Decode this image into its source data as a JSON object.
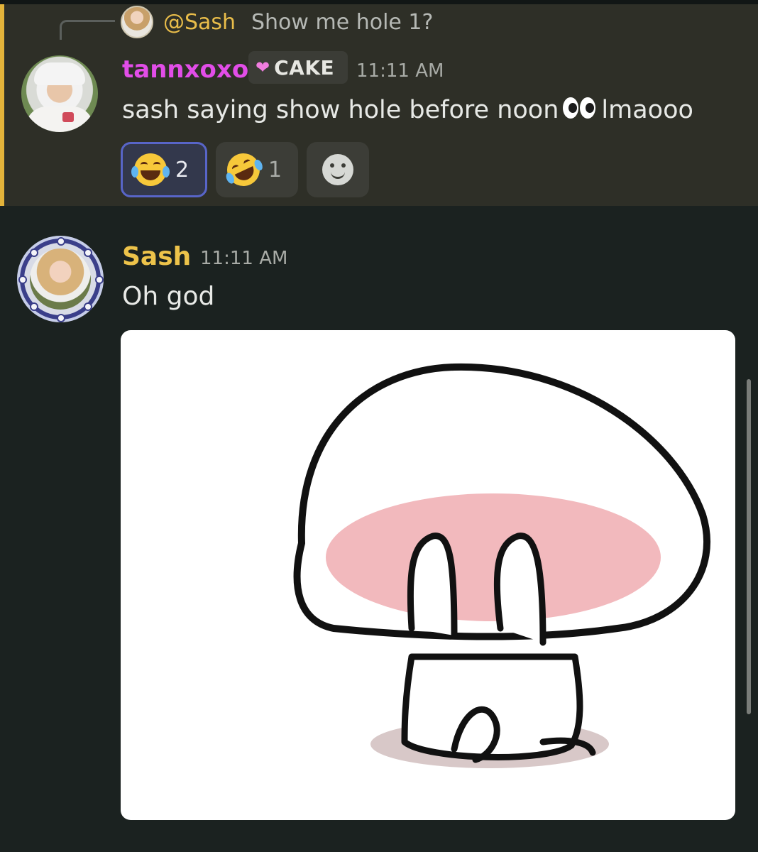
{
  "reply": {
    "author": "@Sash",
    "text": "Show me hole 1?"
  },
  "message1": {
    "author": "tannxoxo",
    "badge": "CAKE",
    "timestamp": "11:11 AM",
    "text_before": "sash saying show hole before noon",
    "text_after": "lmaooo",
    "reactions": [
      {
        "emoji": "joy-emoji",
        "count": "2",
        "selected": true
      },
      {
        "emoji": "rofl-emoji",
        "count": "1",
        "selected": false
      }
    ]
  },
  "message2": {
    "author": "Sash",
    "timestamp": "11:11 AM",
    "text": "Oh god"
  },
  "colors": {
    "background": "#1b2220",
    "mention_highlight": "#2e2f27",
    "mention_bar": "#e3b33a",
    "author1": "#e24de8",
    "author2": "#edc34a"
  }
}
